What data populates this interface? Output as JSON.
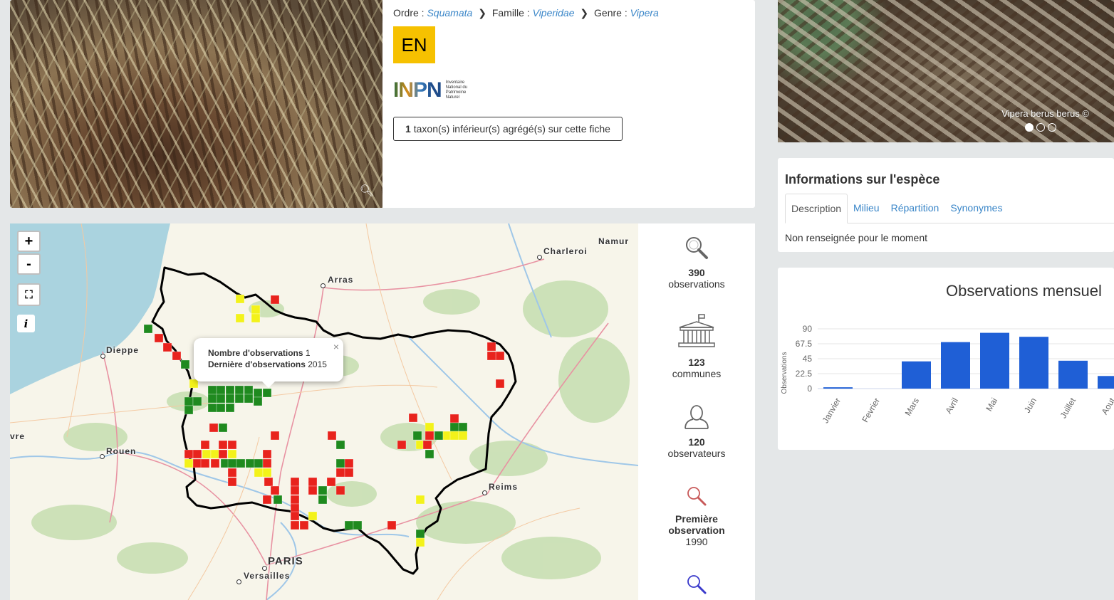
{
  "taxonomy": {
    "ordre_label": "Ordre :",
    "ordre_value": "Squamata",
    "famille_label": "Famille :",
    "famille_value": "Viperidae",
    "genre_label": "Genre :",
    "genre_value": "Vipera"
  },
  "status_badge": "EN",
  "inpn": {
    "logo_text": "INPN",
    "subtitle": "Inventaire National du Patrimoine Naturel"
  },
  "taxon_button": {
    "count": "1",
    "label": " taxon(s) inférieur(s) agrégé(s) sur cette fiche"
  },
  "carousel": {
    "caption": "Vipera berus berus ©",
    "dots": 3,
    "active_dot": 1
  },
  "map": {
    "zoom_in": "+",
    "zoom_out": "-",
    "info": "i",
    "popup": {
      "obs_label": "Nombre d'observations",
      "obs_value": "1",
      "last_label": "Dernière d'observations",
      "last_value": "2015",
      "close": "×"
    },
    "cities": {
      "namur": "Namur",
      "charleroi": "Charleroi",
      "arras": "Arras",
      "dieppe": "Dieppe",
      "rouen": "Rouen",
      "reims": "Reims",
      "paris": "PARIS",
      "versailles": "Versailles",
      "evreux": "vre"
    },
    "colors": {
      "red": "#e8231d",
      "yellow": "#f3f21a",
      "green": "#1f8a1f"
    }
  },
  "stats": [
    {
      "icon": "magnifier-icon",
      "value": "390",
      "label": "observations"
    },
    {
      "icon": "town-hall-icon",
      "value": "123",
      "label": "communes"
    },
    {
      "icon": "person-icon",
      "value": "120",
      "label": "observateurs"
    },
    {
      "icon": "magnifier-red-icon",
      "value": "Première",
      "label": "observation",
      "extra": "1990"
    }
  ],
  "info": {
    "title": "Informations sur l'espèce",
    "tabs": [
      "Description",
      "Milieu",
      "Répartition",
      "Synonymes"
    ],
    "text": "Non renseignée pour le moment"
  },
  "chart_data": {
    "type": "bar",
    "title": "Observations mensuel",
    "ylabel": "Observations",
    "xlabel": "",
    "ylim": [
      0,
      90
    ],
    "yticks": [
      "90",
      "67.5",
      "45",
      "22.5",
      "0"
    ],
    "categories": [
      "Janvier",
      "Fevrier",
      "Mars",
      "Avril",
      "Mai",
      "Juin",
      "Juillet",
      "Aout"
    ],
    "values": [
      2,
      0,
      41,
      70,
      84,
      78,
      42,
      19
    ],
    "color": "#1f5fd6"
  }
}
